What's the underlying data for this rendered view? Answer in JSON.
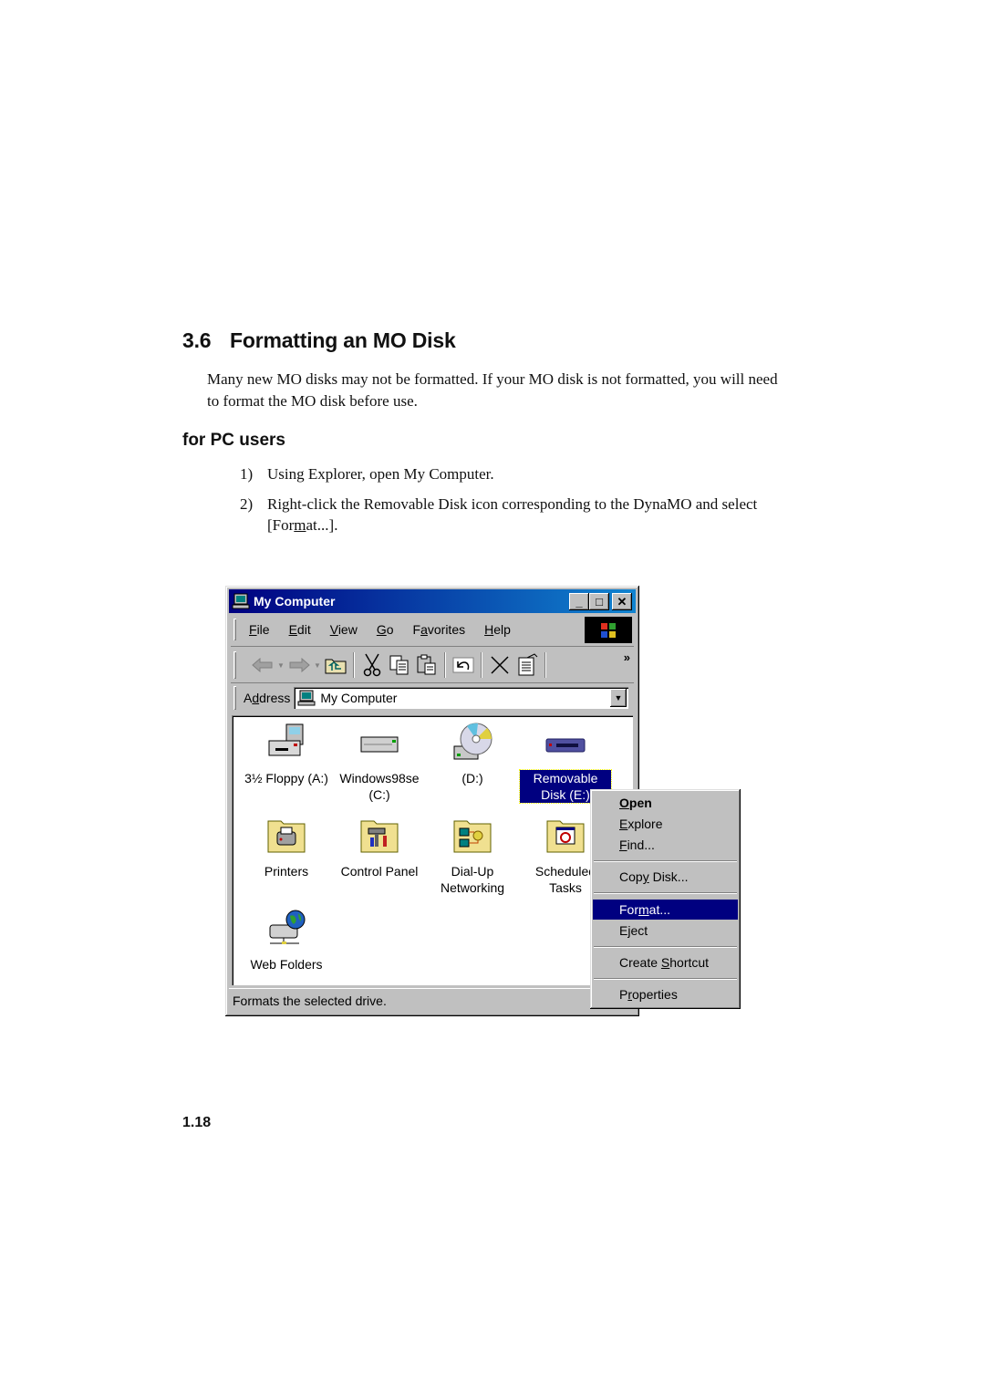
{
  "document": {
    "section_number": "3.6",
    "section_title": "Formatting an MO Disk",
    "intro": "Many new MO disks may not be formatted. If your MO disk is not formatted, you will need to format the MO disk before use.",
    "subheading": "for PC users",
    "steps": [
      {
        "number": "1)",
        "text": "Using Explorer, open My Computer."
      },
      {
        "number": "2)",
        "text_before": "Right-click the Removable Disk icon corresponding to the DynaMO and select [For",
        "text_mnemonic": "m",
        "text_after": "at...]."
      }
    ],
    "page_number": "1.18"
  },
  "window": {
    "title": "My Computer",
    "title_icon": "computer-icon",
    "controls": {
      "minimize": "_",
      "maximize": "□",
      "close": "✕"
    },
    "menu": [
      {
        "mn": "F",
        "rest": "ile"
      },
      {
        "mn": "E",
        "rest": "dit"
      },
      {
        "mn": "V",
        "rest": "iew"
      },
      {
        "mn": "G",
        "rest": "o"
      },
      {
        "pre": "F",
        "mn": "a",
        "rest": "vorites"
      },
      {
        "mn": "H",
        "rest": "elp"
      }
    ],
    "toolbar": [
      "back-icon",
      "forward-icon",
      "up-folder-icon",
      "cut-icon",
      "copy-icon",
      "paste-icon",
      "undo-icon",
      "delete-icon",
      "properties-icon"
    ],
    "toolbar_overflow": "»",
    "address": {
      "label_pre": "A",
      "label_mn": "d",
      "label_rest": "dress",
      "value": "My Computer"
    },
    "items": [
      {
        "label": "3½ Floppy (A:)",
        "icon": "floppy-drive-icon"
      },
      {
        "label": "Windows98se (C:)",
        "icon": "hard-drive-icon"
      },
      {
        "label": "(D:)",
        "icon": "cd-drive-icon"
      },
      {
        "label": "Removable Disk (E:)",
        "icon": "removable-disk-icon",
        "selected": true
      },
      {
        "label": "Printers",
        "icon": "printers-folder-icon"
      },
      {
        "label": "Control Panel",
        "icon": "control-panel-folder-icon"
      },
      {
        "label": "Dial-Up Networking",
        "icon": "dialup-networking-folder-icon"
      },
      {
        "label": "Scheduled Tasks",
        "icon": "scheduled-tasks-folder-icon"
      },
      {
        "label": "Web Folders",
        "icon": "web-folders-icon"
      }
    ],
    "status": "Formats the selected drive."
  },
  "context_menu": {
    "items": [
      {
        "mn": "O",
        "rest": "pen",
        "bold": true
      },
      {
        "mn": "E",
        "rest": "xplore"
      },
      {
        "mn": "F",
        "rest": "ind..."
      },
      {
        "separator": true
      },
      {
        "pre": "Cop",
        "mn": "y",
        "rest": " Disk..."
      },
      {
        "separator": true
      },
      {
        "pre": "For",
        "mn": "m",
        "rest": "at...",
        "highlighted": true
      },
      {
        "pre": "Ejec",
        "mn": "",
        "rest": "t"
      },
      {
        "separator": true
      },
      {
        "pre": "Create ",
        "mn": "S",
        "rest": "hortcut"
      },
      {
        "separator": true
      },
      {
        "pre": "P",
        "mn": "r",
        "rest": "operties"
      }
    ]
  },
  "colors": {
    "title_start": "#000080",
    "title_end": "#1084d0",
    "highlight": "#000080",
    "chrome": "#c0c0c0"
  }
}
